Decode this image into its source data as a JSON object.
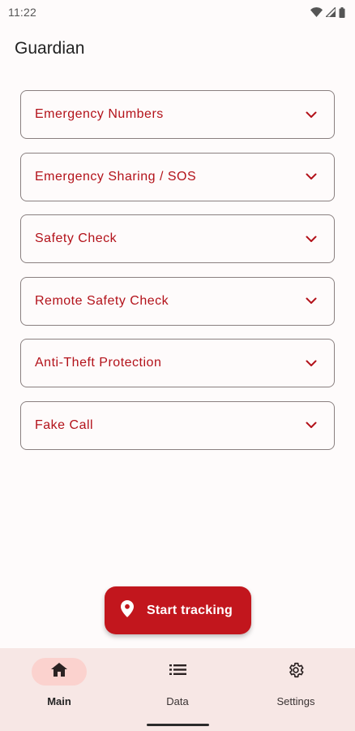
{
  "status_bar": {
    "time": "11:22"
  },
  "app_title": "Guardian",
  "sections": [
    {
      "label": "Emergency Numbers"
    },
    {
      "label": "Emergency Sharing / SOS"
    },
    {
      "label": "Safety Check"
    },
    {
      "label": "Remote Safety Check"
    },
    {
      "label": "Anti-Theft Protection"
    },
    {
      "label": "Fake Call"
    }
  ],
  "fab": {
    "label": "Start tracking",
    "icon": "location-pin-icon"
  },
  "bottom_nav": [
    {
      "label": "Main",
      "icon": "home-icon",
      "active": true
    },
    {
      "label": "Data",
      "icon": "list-icon",
      "active": false
    },
    {
      "label": "Settings",
      "icon": "gear-icon",
      "active": false
    }
  ],
  "colors": {
    "accent": "#c2161d",
    "section_text": "#b3121a",
    "nav_background": "#f7e7e5",
    "nav_active_pill": "#fbd2ce"
  }
}
